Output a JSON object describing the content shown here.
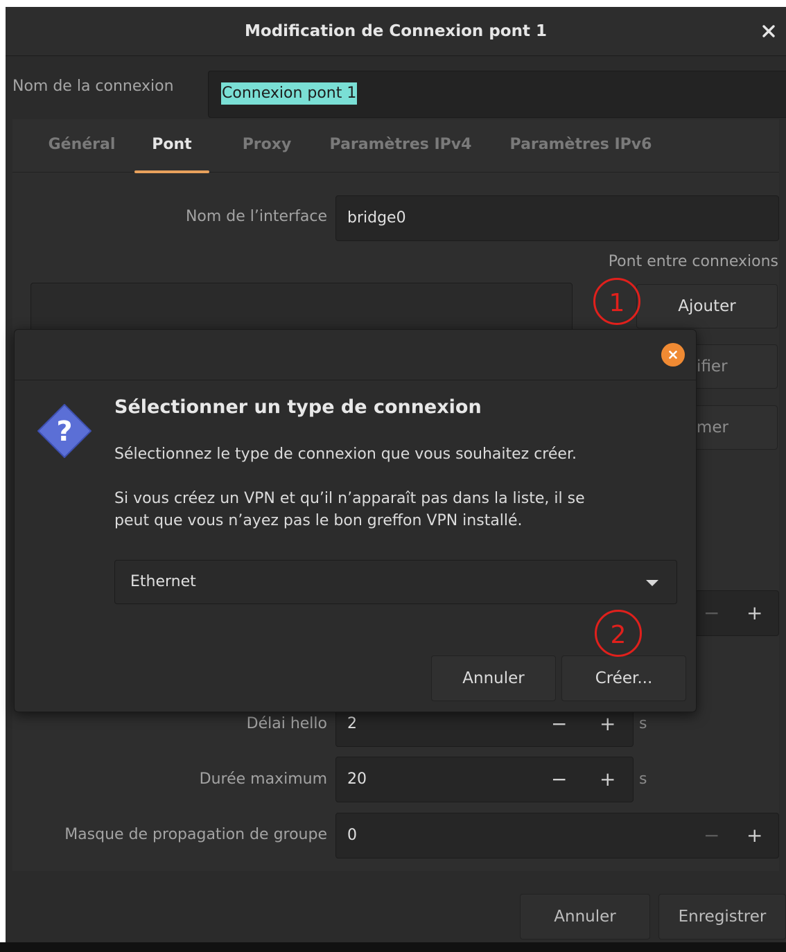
{
  "window": {
    "title": "Modification de Connexion pont 1",
    "connection_name_label": "Nom de la connexion",
    "connection_name_value": "Connexion pont 1"
  },
  "tabs": [
    {
      "label": "Général",
      "active": false
    },
    {
      "label": "Pont",
      "active": true
    },
    {
      "label": "Proxy",
      "active": false
    },
    {
      "label": "Paramètres IPv4",
      "active": false
    },
    {
      "label": "Paramètres IPv6",
      "active": false
    }
  ],
  "bridge": {
    "interface_label": "Nom de l’interface",
    "interface_value": "bridge0",
    "bridged_connections_label": "Pont entre connexions",
    "add_button": "Ajouter",
    "edit_button_partial": "difier",
    "delete_button_partial": "rimer",
    "hello_delay_label": "Délai hello",
    "hello_delay_value": "2",
    "max_age_label": "Durée maximum",
    "max_age_value": "20",
    "group_fwd_mask_label": "Masque de propagation de groupe",
    "group_fwd_mask_value": "0",
    "unit_seconds": "s",
    "minus": "−",
    "plus": "+"
  },
  "footer": {
    "cancel": "Annuler",
    "save": "Enregistrer"
  },
  "dialog": {
    "title": "Sélectionner un type de connexion",
    "line1": "Sélectionnez le type de connexion que vous souhaitez créer.",
    "line2a": "Si vous créez un VPN et qu’il n’apparaît pas dans la liste, il se",
    "line2b": "peut que vous n’ayez pas le bon greffon VPN installé.",
    "type_value": "Ethernet",
    "cancel": "Annuler",
    "create": "Créer..."
  },
  "annotations": [
    "1",
    "2"
  ],
  "colors": {
    "accent_tab": "#e8a15c",
    "selection_highlight": "#7adfd5",
    "dialog_close": "#f08a33",
    "question_icon": "#5b6fd6",
    "annotation": "#e0201c"
  },
  "icons": {
    "window_close": "close-icon",
    "dialog_close": "close-circle-icon",
    "question": "question-diamond-icon",
    "dropdown": "chevron-down-icon"
  }
}
